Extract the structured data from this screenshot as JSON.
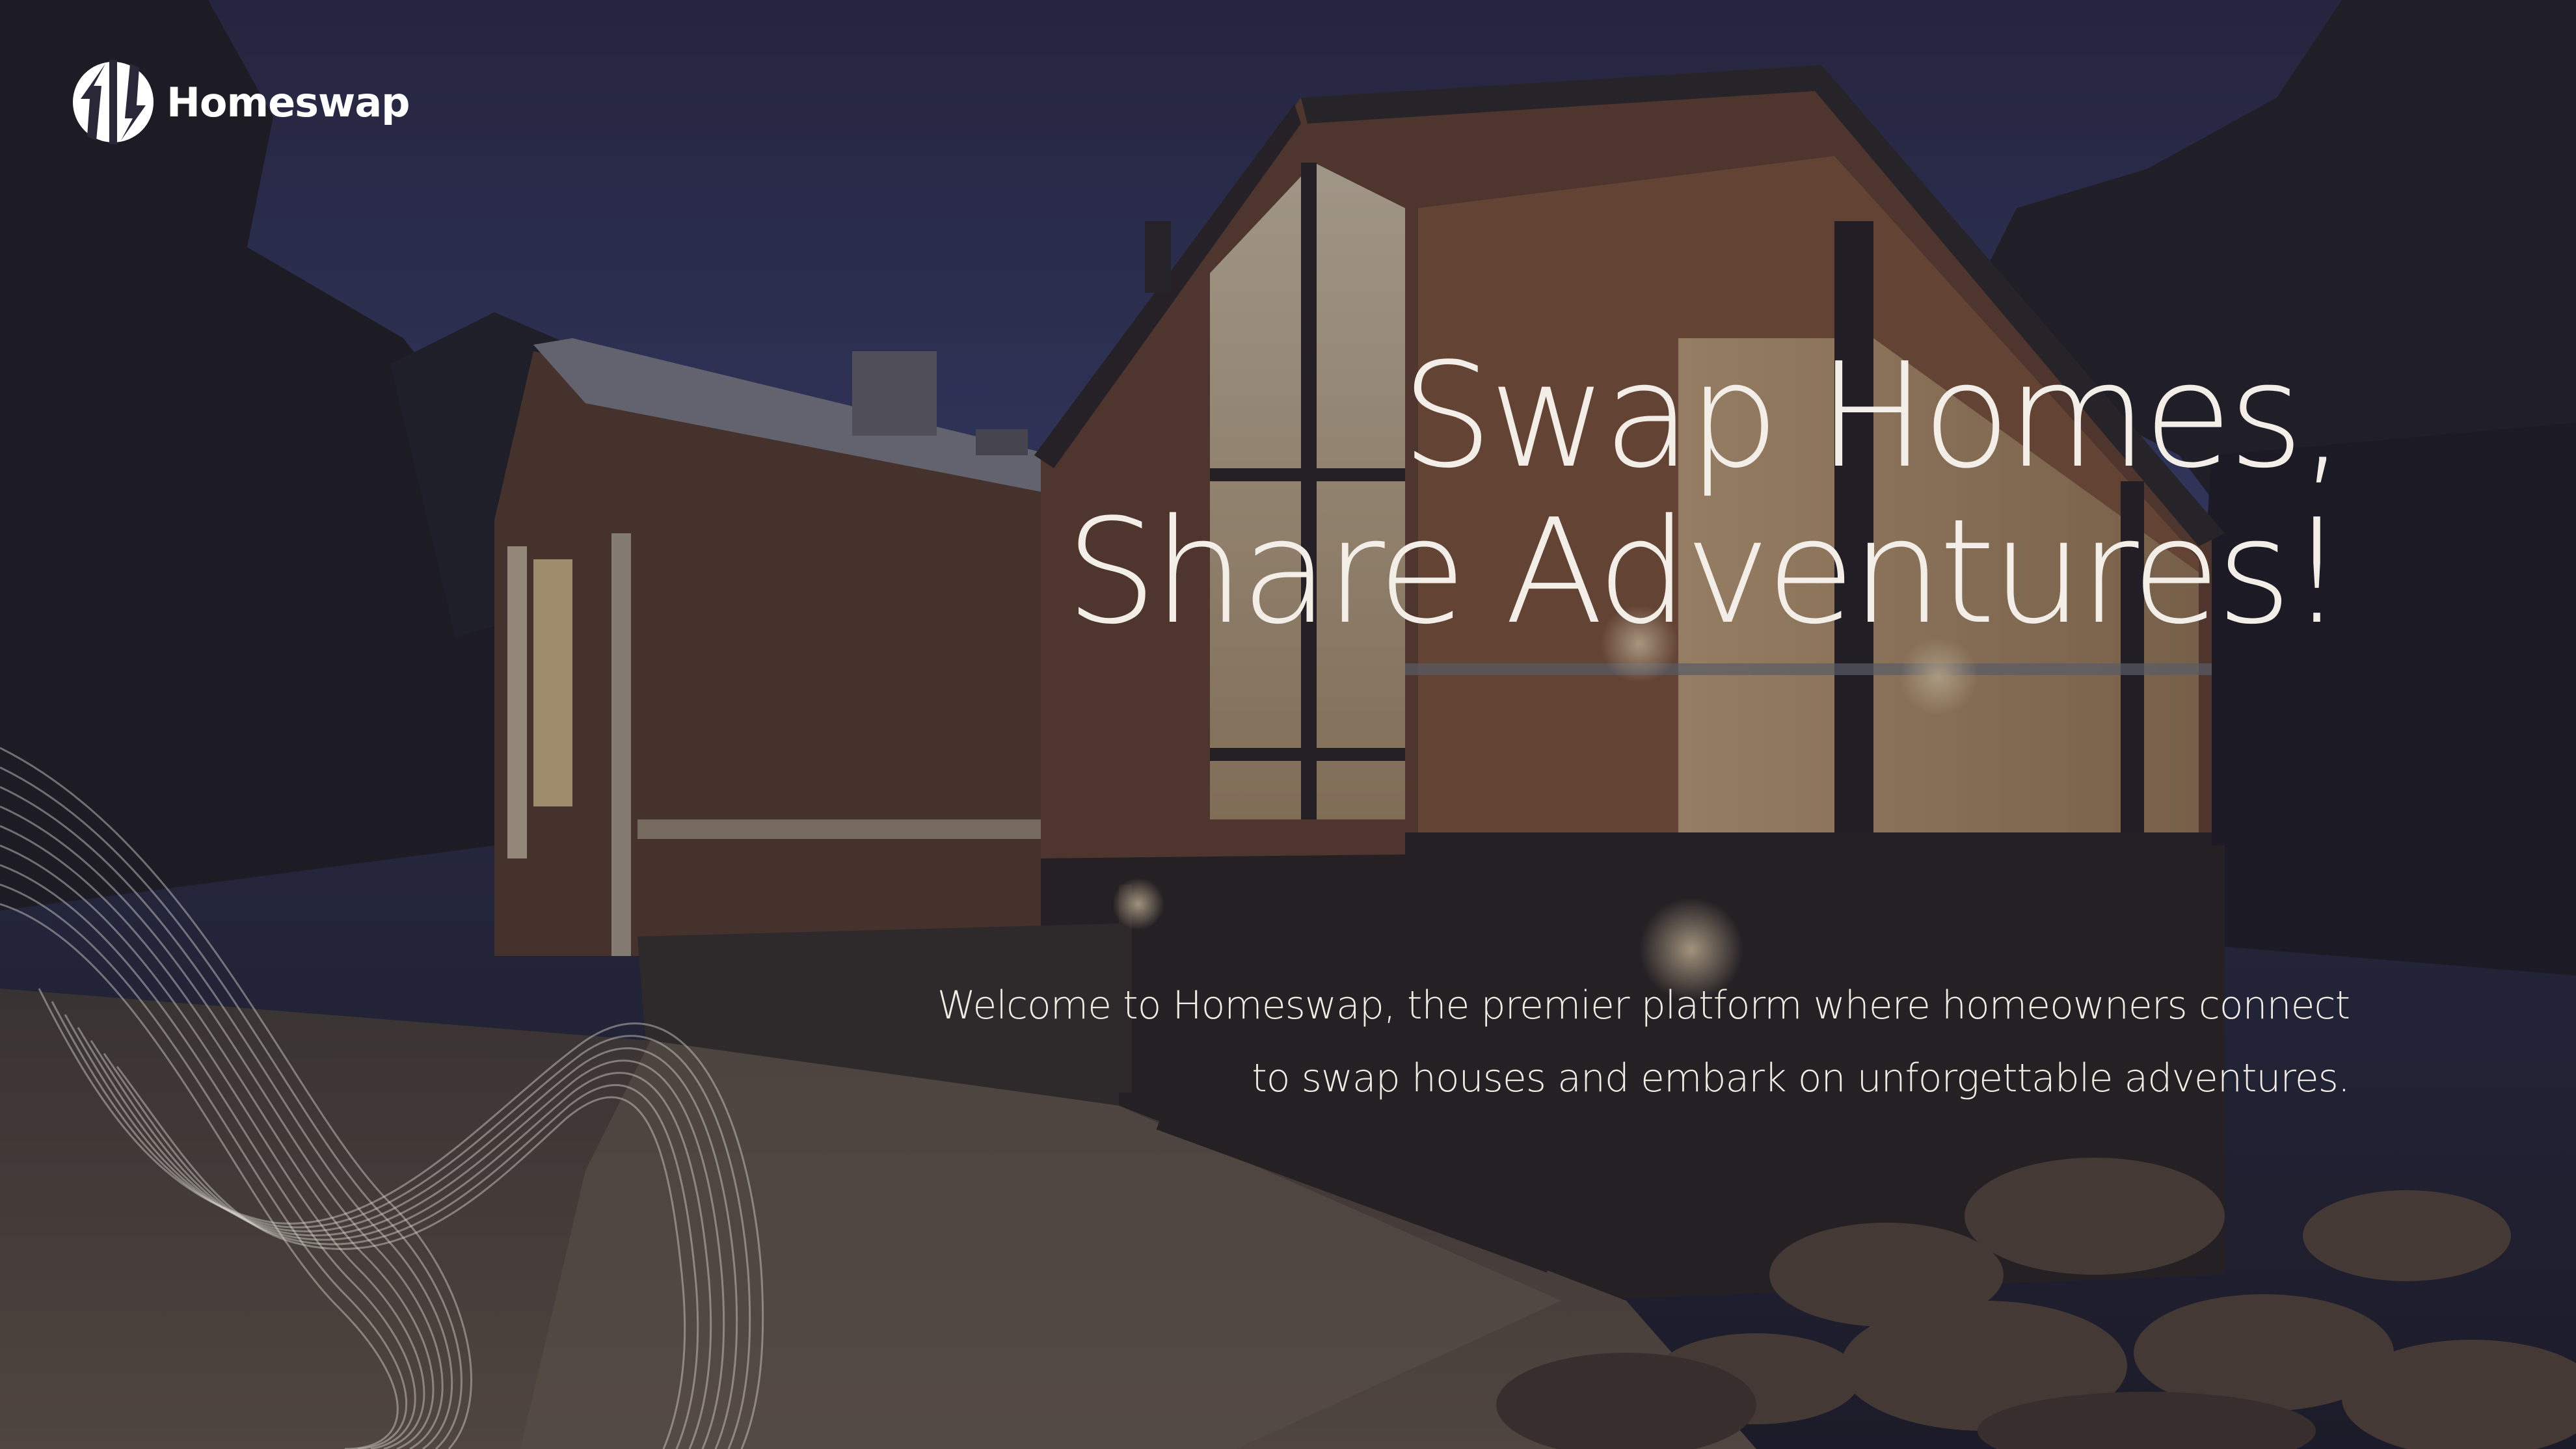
{
  "brand": {
    "name": "Homeswap",
    "logo_icon": "homeswap-arrows-icon"
  },
  "hero": {
    "headline_line1": "Swap Homes,",
    "headline_line2": "Share Adventures!",
    "description_line1": "Welcome to Homeswap, the premier platform where homeowners connect",
    "description_line2": "to swap houses and embark on unforgettable adventures."
  },
  "colors": {
    "overlay": "#1b1a2a",
    "text": "#f3efe8",
    "sky": "#3a4170",
    "warm_light": "#f7d9a3"
  }
}
